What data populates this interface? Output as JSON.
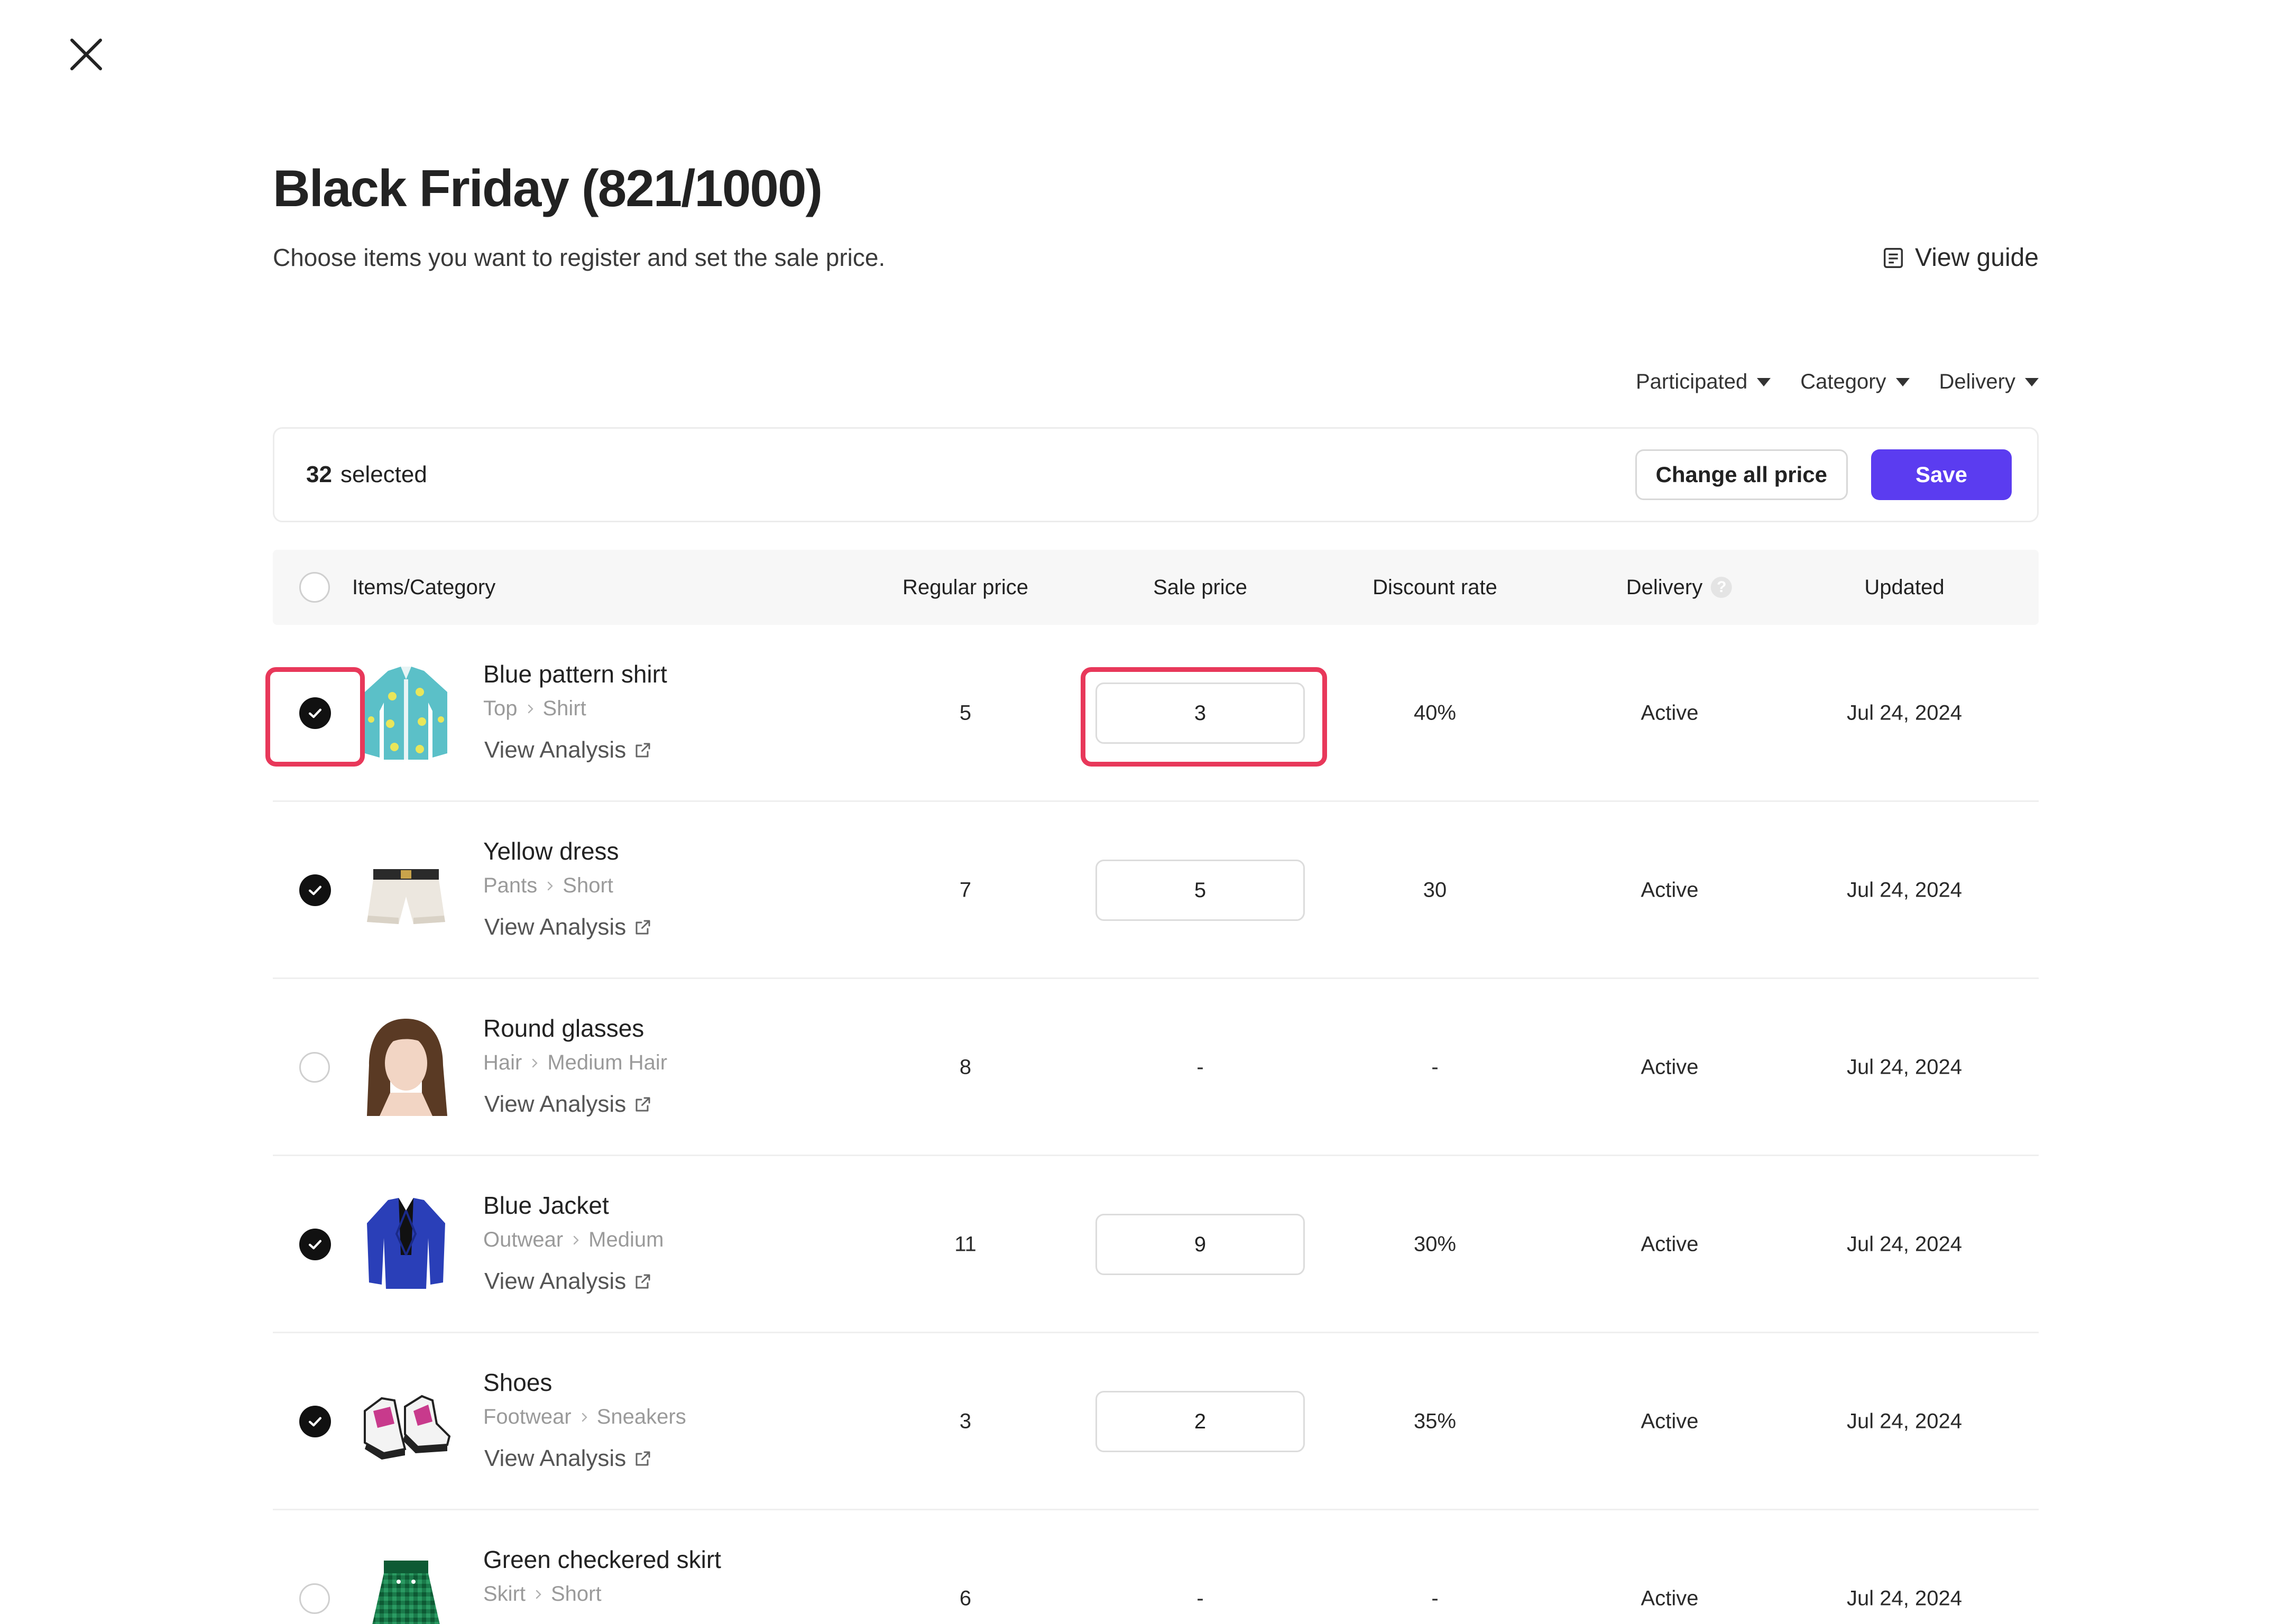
{
  "page": {
    "title": "Black Friday (821/1000)",
    "subtitle": "Choose items you want to register and set the sale price.",
    "view_guide": "View guide"
  },
  "filters": [
    "Participated",
    "Category",
    "Delivery"
  ],
  "selection": {
    "count": "32",
    "label": "selected",
    "change_all": "Change all price",
    "save": "Save"
  },
  "columns": {
    "items": "Items/Category",
    "regular": "Regular price",
    "sale": "Sale price",
    "discount": "Discount rate",
    "delivery": "Delivery",
    "delivery_help": "?",
    "updated": "Updated"
  },
  "link_label": "View Analysis",
  "rows": [
    {
      "name": "Blue pattern shirt",
      "cat": "Top",
      "sub": "Shirt",
      "regular": "5",
      "sale": "3",
      "discount": "40%",
      "delivery": "Active",
      "updated": "Jul 24, 2024",
      "checked": true,
      "thumb": "shirt"
    },
    {
      "name": "Yellow dress",
      "cat": "Pants",
      "sub": "Short",
      "regular": "7",
      "sale": "5",
      "discount": "30",
      "delivery": "Active",
      "updated": "Jul 24, 2024",
      "checked": true,
      "thumb": "shorts"
    },
    {
      "name": "Round glasses",
      "cat": "Hair",
      "sub": "Medium Hair",
      "regular": "8",
      "sale": "-",
      "discount": "-",
      "delivery": "Active",
      "updated": "Jul 24, 2024",
      "checked": false,
      "thumb": "hair"
    },
    {
      "name": "Blue Jacket",
      "cat": "Outwear",
      "sub": "Medium",
      "regular": "11",
      "sale": "9",
      "discount": "30%",
      "delivery": "Active",
      "updated": "Jul 24, 2024",
      "checked": true,
      "thumb": "jacket"
    },
    {
      "name": "Shoes",
      "cat": "Footwear",
      "sub": "Sneakers",
      "regular": "3",
      "sale": "2",
      "discount": "35%",
      "delivery": "Active",
      "updated": "Jul 24, 2024",
      "checked": true,
      "thumb": "shoes"
    },
    {
      "name": "Green checkered skirt",
      "cat": "Skirt",
      "sub": "Short",
      "regular": "6",
      "sale": "-",
      "discount": "-",
      "delivery": "Active",
      "updated": "Jul 24, 2024",
      "checked": false,
      "thumb": "skirt"
    }
  ],
  "colors": {
    "accent": "#5b3cf0",
    "highlight": "#e8385a"
  },
  "icons": {
    "close": "close-icon",
    "guide": "document-icon",
    "link": "external-link-icon"
  }
}
